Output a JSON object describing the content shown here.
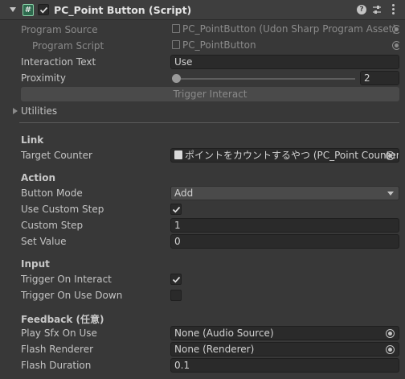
{
  "header": {
    "title": "PC_Point Button (Script)",
    "enabled": true,
    "icons": [
      "foldout-arrow-icon",
      "script-icon",
      "help-icon",
      "presets-icon",
      "kebab-menu-icon"
    ]
  },
  "fields": {
    "program_source": {
      "label": "Program Source",
      "value": "PC_PointButton (Udon Sharp Program Asset)"
    },
    "program_script": {
      "label": "Program Script",
      "value": "PC_PointButton"
    },
    "interaction_text": {
      "label": "Interaction Text",
      "value": "Use"
    },
    "proximity": {
      "label": "Proximity",
      "value": "2"
    },
    "trigger_interact": {
      "label": "Trigger Interact"
    },
    "utilities": {
      "label": "Utilities"
    }
  },
  "link": {
    "header": "Link",
    "target_counter": {
      "label": "Target Counter",
      "value": "ポイントをカウントするやつ (PC_Point Counter)"
    }
  },
  "action": {
    "header": "Action",
    "button_mode": {
      "label": "Button Mode",
      "value": "Add"
    },
    "use_custom_step": {
      "label": "Use Custom Step",
      "checked": true
    },
    "custom_step": {
      "label": "Custom Step",
      "value": "1"
    },
    "set_value": {
      "label": "Set Value",
      "value": "0"
    }
  },
  "input": {
    "header": "Input",
    "trigger_on_interact": {
      "label": "Trigger On Interact",
      "checked": true
    },
    "trigger_on_use_down": {
      "label": "Trigger On Use Down",
      "checked": false
    }
  },
  "feedback": {
    "header": "Feedback (任意)",
    "play_sfx_on_use": {
      "label": "Play Sfx On Use",
      "value": "None (Audio Source)"
    },
    "flash_renderer": {
      "label": "Flash Renderer",
      "value": "None (Renderer)"
    },
    "flash_duration": {
      "label": "Flash Duration",
      "value": "0.1"
    }
  }
}
